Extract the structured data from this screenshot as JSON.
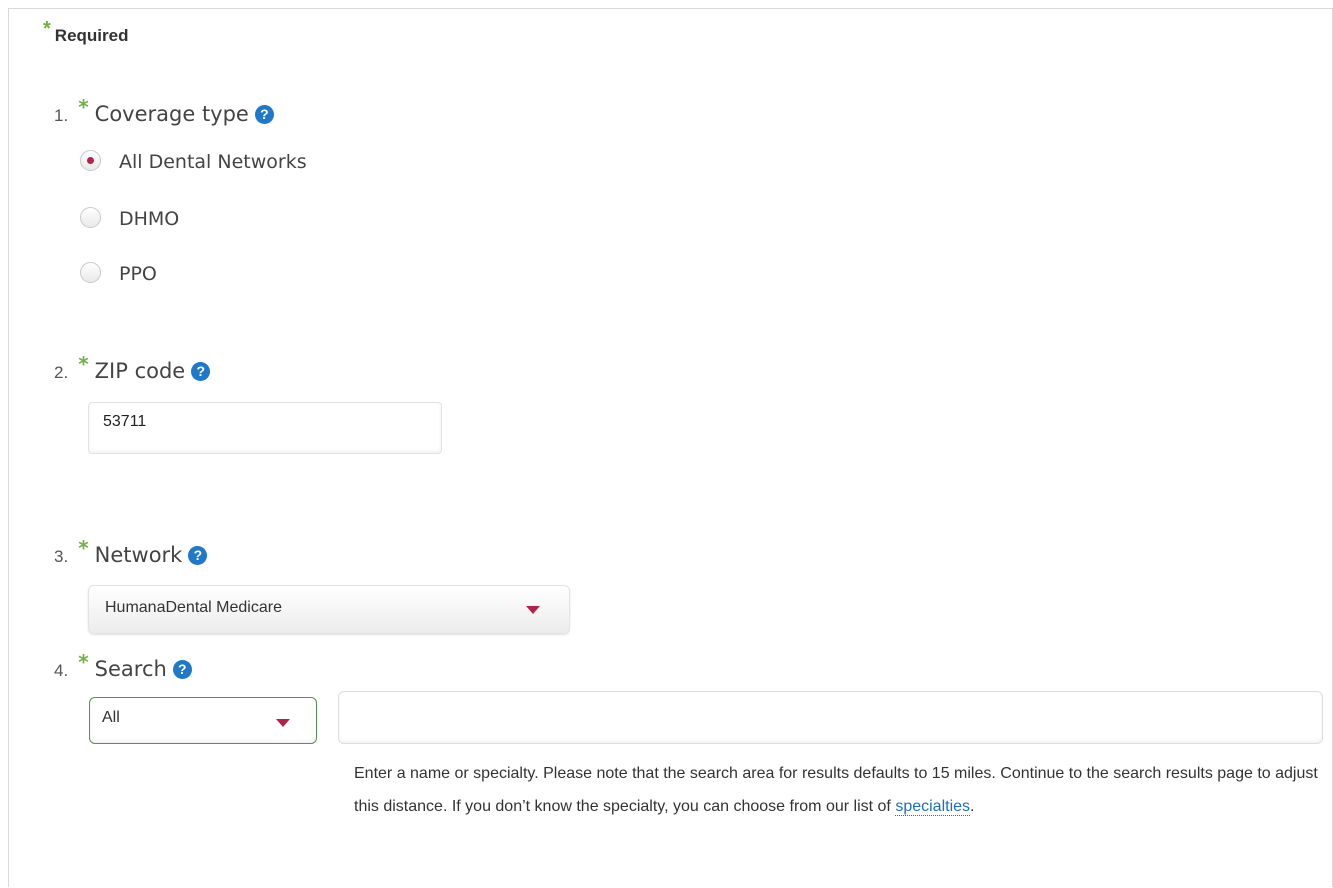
{
  "required_label": "Required",
  "star": "*",
  "help_glyph": "?",
  "q1": {
    "num": "1.",
    "label": "Coverage type",
    "options": [
      "All Dental Networks",
      "DHMO",
      "PPO"
    ],
    "selected": "All Dental Networks"
  },
  "q2": {
    "num": "2.",
    "label": "ZIP code",
    "value": "53711"
  },
  "q3": {
    "num": "3.",
    "label": "Network",
    "selected": "HumanaDental Medicare"
  },
  "q4": {
    "num": "4.",
    "label": "Search",
    "filter_selected": "All",
    "input_value": "",
    "note_text": "Enter a name or specialty. Please note that the search area for results defaults to 15 miles. Continue to the search results page to adjust this distance. If you don’t know the specialty, you can choose from our list of ",
    "note_link": "specialties",
    "note_end": "."
  },
  "colors": {
    "required_star": "#6cb33f",
    "help_icon": "#1f78c8",
    "accent": "#b3224b",
    "link": "#1f6fb8"
  }
}
